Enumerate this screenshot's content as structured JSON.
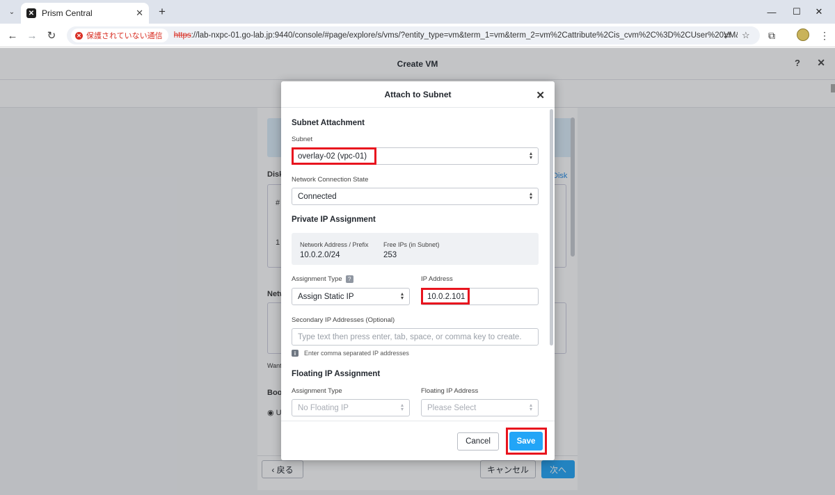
{
  "browser": {
    "tab_title": "Prism Central",
    "security_label": "保護されていない通信",
    "url_scheme": "https",
    "url_rest": "://lab-nxpc-01.go-lab.jp:9440/console/#page/explore/s/vms/?entity_type=vm&term_1=vm&term_2=vm%2Cattribute%2Cis_cvm%2C%3D%2CUser%20VM&term..."
  },
  "page": {
    "title": "Create VM",
    "help": "?",
    "close": "✕",
    "bg_labels": {
      "disk": "Disk",
      "disk_link": "Disk",
      "hash": "#",
      "row1": "1",
      "network": "Netw",
      "want": "Want",
      "boot": "Boot",
      "radio_u": "U"
    },
    "footer": {
      "back": "‹  戻る",
      "cancel": "キャンセル",
      "next": "次へ"
    }
  },
  "modal": {
    "title": "Attach to Subnet",
    "subnet_section": "Subnet Attachment",
    "subnet_label": "Subnet",
    "subnet_value": "overlay-02 (vpc-01)",
    "connection_label": "Network Connection State",
    "connection_value": "Connected",
    "private_ip_section": "Private IP Assignment",
    "network_address_label": "Network Address / Prefix",
    "network_address_value": "10.0.2.0/24",
    "free_ips_label": "Free IPs (in Subnet)",
    "free_ips_value": "253",
    "assignment_type_label": "Assignment Type",
    "assignment_type_help": "?",
    "assignment_type_value": "Assign Static IP",
    "ip_address_label": "IP Address",
    "ip_address_value": "10.0.2.101",
    "secondary_label": "Secondary IP Addresses (Optional)",
    "secondary_placeholder": "Type text then press enter, tab, space, or comma key to create.",
    "secondary_hint": "Enter comma separated IP addresses",
    "floating_section": "Floating IP Assignment",
    "floating_type_label": "Assignment Type",
    "floating_type_value": "No Floating IP",
    "floating_address_label": "Floating IP Address",
    "floating_address_value": "Please Select",
    "cancel_label": "Cancel",
    "save_label": "Save"
  },
  "colors": {
    "accent": "#22a5f7",
    "highlight": "#e8141e",
    "warning": "#d93025"
  }
}
